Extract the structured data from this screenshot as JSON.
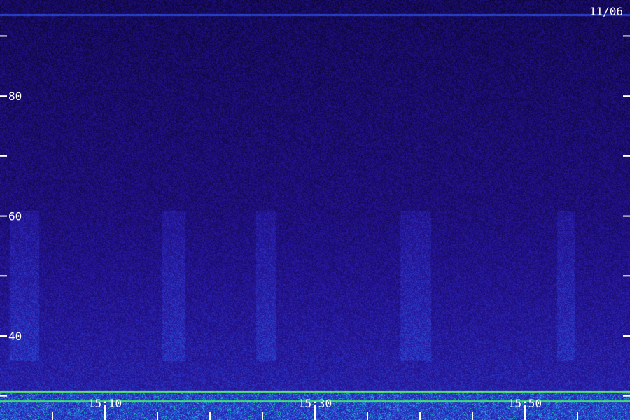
{
  "chart_data": {
    "type": "heatmap",
    "date_label": "11/06",
    "y_ticks": [
      {
        "value": 30,
        "label": ""
      },
      {
        "value": 40,
        "label": "40"
      },
      {
        "value": 50,
        "label": ""
      },
      {
        "value": 60,
        "label": "60"
      },
      {
        "value": 70,
        "label": ""
      },
      {
        "value": 80,
        "label": "80"
      },
      {
        "value": 90,
        "label": ""
      }
    ],
    "y_range": [
      26,
      96
    ],
    "x_ticks": [
      {
        "value": "15:05",
        "label": ""
      },
      {
        "value": "15:10",
        "label": "15:10"
      },
      {
        "value": "15:15",
        "label": ""
      },
      {
        "value": "15:20",
        "label": ""
      },
      {
        "value": "15:25",
        "label": ""
      },
      {
        "value": "15:30",
        "label": "15:30"
      },
      {
        "value": "15:35",
        "label": ""
      },
      {
        "value": "15:40",
        "label": ""
      },
      {
        "value": "15:45",
        "label": ""
      },
      {
        "value": "15:50",
        "label": "15:50"
      },
      {
        "value": "15:55",
        "label": ""
      }
    ],
    "x_range": [
      "15:00",
      "16:00"
    ],
    "colormap": [
      "#0a0428",
      "#1a0c6e",
      "#2a1aa8",
      "#2850d8",
      "#1fb0e0",
      "#38e070",
      "#b8f040"
    ]
  }
}
